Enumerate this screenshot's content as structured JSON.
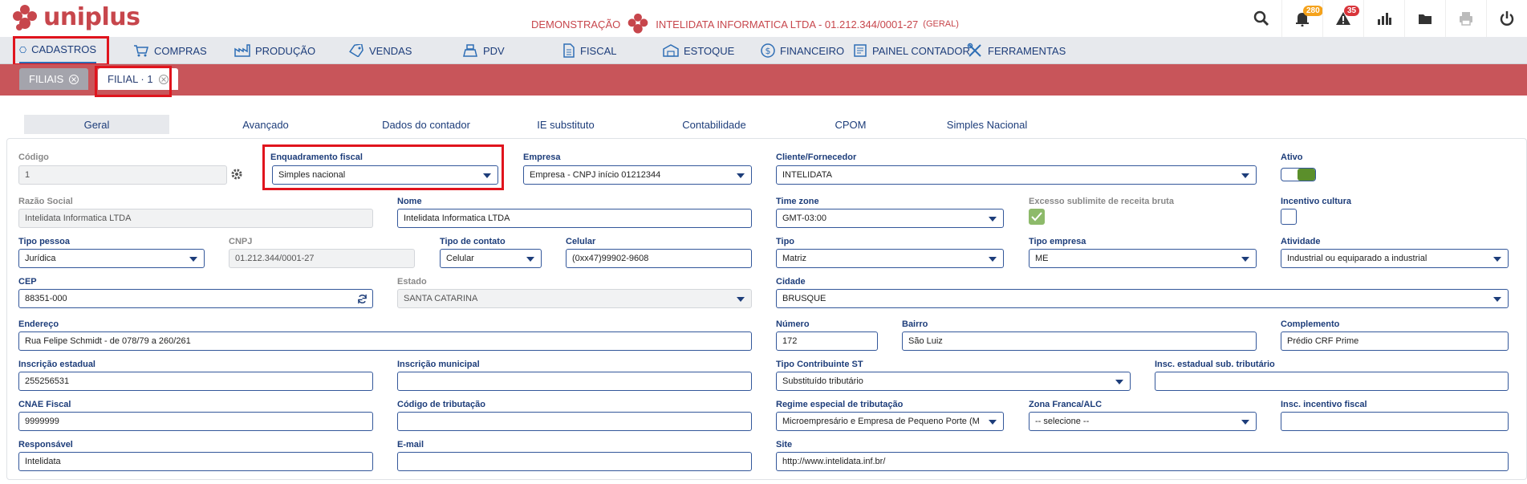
{
  "brand": {
    "name": "uniplus"
  },
  "company": {
    "mode": "DEMONSTRAÇÃO",
    "name": "INTELIDATA INFORMATICA LTDA - 01.212.344/0001-27",
    "scope": "(GERAL)"
  },
  "badges": {
    "notifications": "280",
    "alerts": "35"
  },
  "colors": {
    "brand": "#c7464c",
    "accent": "#1d3d7a",
    "highlight": "#e0141d"
  },
  "menu": [
    {
      "label": "CADASTROS",
      "icon": "hexagon-icon"
    },
    {
      "label": "COMPRAS",
      "icon": "cart-icon"
    },
    {
      "label": "PRODUÇÃO",
      "icon": "factory-icon"
    },
    {
      "label": "VENDAS",
      "icon": "tag-icon"
    },
    {
      "label": "PDV",
      "icon": "register-icon"
    },
    {
      "label": "FISCAL",
      "icon": "document-icon"
    },
    {
      "label": "ESTOQUE",
      "icon": "warehouse-icon"
    },
    {
      "label": "FINANCEIRO",
      "icon": "dollar-icon"
    },
    {
      "label": "PAINEL CONTADOR",
      "icon": "ledger-icon"
    },
    {
      "label": "FERRAMENTAS",
      "icon": "tools-icon"
    }
  ],
  "tabs": [
    {
      "label": "FILIAIS"
    },
    {
      "label": "FILIAL · 1"
    }
  ],
  "section_tabs": [
    "Geral",
    "Avançado",
    "Dados do contador",
    "IE substituto",
    "Contabilidade",
    "CPOM",
    "Simples Nacional"
  ],
  "form": {
    "codigo": {
      "label": "Código",
      "value": "1"
    },
    "enquadramento": {
      "label": "Enquadramento fiscal",
      "value": "Simples nacional"
    },
    "empresa": {
      "label": "Empresa",
      "value": "Empresa - CNPJ início 01212344"
    },
    "cliente": {
      "label": "Cliente/Fornecedor",
      "value": "INTELIDATA"
    },
    "ativo": {
      "label": "Ativo",
      "checked": true
    },
    "razao": {
      "label": "Razão Social",
      "value": "Intelidata Informatica LTDA"
    },
    "nome": {
      "label": "Nome",
      "value": "Intelidata Informatica LTDA"
    },
    "timezone": {
      "label": "Time zone",
      "value": "GMT-03:00"
    },
    "excesso": {
      "label": "Excesso sublimite de receita bruta",
      "checked": true
    },
    "incentivo": {
      "label": "Incentivo cultura",
      "checked": false
    },
    "tipo_pessoa": {
      "label": "Tipo pessoa",
      "value": "Jurídica"
    },
    "cnpj": {
      "label": "CNPJ",
      "value": "01.212.344/0001-27"
    },
    "tipo_contato": {
      "label": "Tipo de contato",
      "value": "Celular"
    },
    "celular": {
      "label": "Celular",
      "value": "(0xx47)99902-9608"
    },
    "tipo": {
      "label": "Tipo",
      "value": "Matriz"
    },
    "tipo_empresa": {
      "label": "Tipo empresa",
      "value": "ME"
    },
    "atividade": {
      "label": "Atividade",
      "value": "Industrial ou equiparado a industrial"
    },
    "cep": {
      "label": "CEP",
      "value": "88351-000"
    },
    "estado": {
      "label": "Estado",
      "value": "SANTA CATARINA"
    },
    "cidade": {
      "label": "Cidade",
      "value": "BRUSQUE"
    },
    "endereco": {
      "label": "Endereço",
      "value": "Rua Felipe Schmidt - de 078/79 a 260/261"
    },
    "numero": {
      "label": "Número",
      "value": "172"
    },
    "bairro": {
      "label": "Bairro",
      "value": "São Luiz"
    },
    "complemento": {
      "label": "Complemento",
      "value": "Prédio CRF Prime"
    },
    "ie": {
      "label": "Inscrição estadual",
      "value": "255256531"
    },
    "im": {
      "label": "Inscrição municipal",
      "value": ""
    },
    "tipo_contrib": {
      "label": "Tipo Contribuinte ST",
      "value": "Substituído tributário"
    },
    "ie_sub": {
      "label": "Insc. estadual sub. tributário",
      "value": ""
    },
    "cnae": {
      "label": "CNAE Fiscal",
      "value": "9999999"
    },
    "cod_trib": {
      "label": "Código de tributação",
      "value": ""
    },
    "regime": {
      "label": "Regime especial de tributação",
      "value": "Microempresário e Empresa de Pequeno Porte (M"
    },
    "zona": {
      "label": "Zona Franca/ALC",
      "value": "-- selecione --"
    },
    "insc_incentivo": {
      "label": "Insc. incentivo fiscal",
      "value": ""
    },
    "responsavel": {
      "label": "Responsável",
      "value": "Intelidata"
    },
    "email": {
      "label": "E-mail",
      "value": ""
    },
    "site": {
      "label": "Site",
      "value": "http://www.intelidata.inf.br/"
    }
  }
}
